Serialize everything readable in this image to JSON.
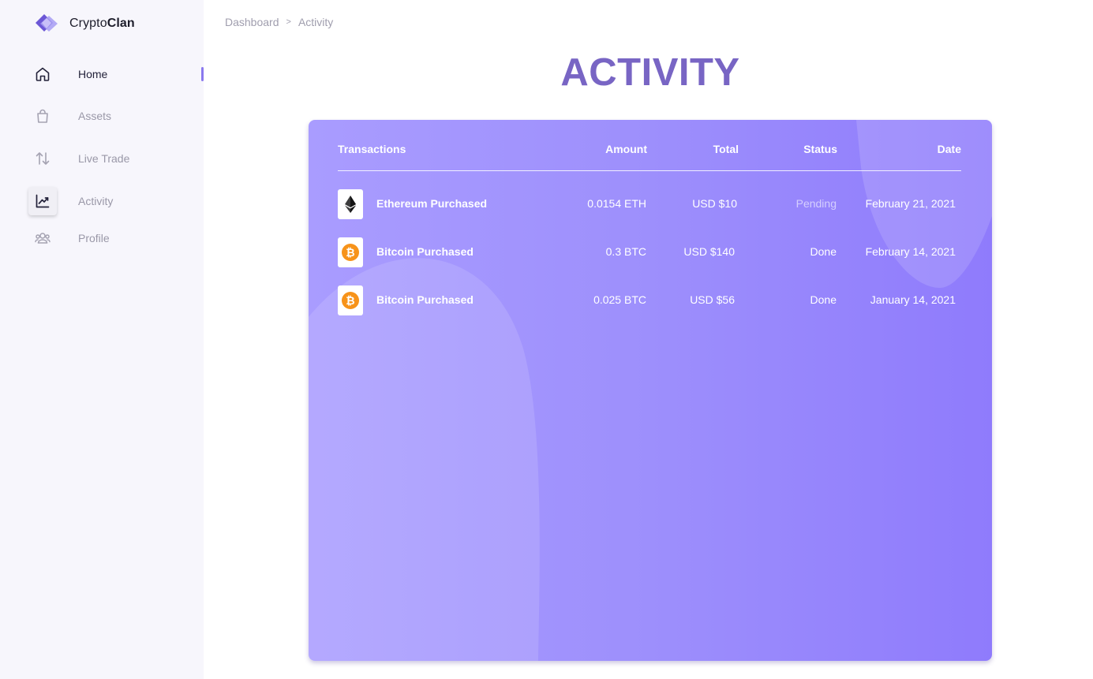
{
  "brand": {
    "name_regular": "Crypto",
    "name_bold": "Clan"
  },
  "sidebar": {
    "items": [
      {
        "label": "Home",
        "icon": "home-icon"
      },
      {
        "label": "Assets",
        "icon": "bag-icon"
      },
      {
        "label": "Live Trade",
        "icon": "arrows-up-down-icon"
      },
      {
        "label": "Activity",
        "icon": "chart-line-icon"
      },
      {
        "label": "Profile",
        "icon": "users-icon"
      }
    ]
  },
  "breadcrumb": {
    "parent": "Dashboard",
    "separator": ">",
    "current": "Activity"
  },
  "page": {
    "title": "ACTIVITY"
  },
  "table": {
    "headers": {
      "transactions": "Transactions",
      "amount": "Amount",
      "total": "Total",
      "status": "Status",
      "date": "Date"
    },
    "rows": [
      {
        "coin": "ethereum-icon",
        "name": "Ethereum Purchased",
        "amount": "0.0154 ETH",
        "total": "USD $10",
        "status": "Pending",
        "date": "February 21, 2021"
      },
      {
        "coin": "bitcoin-icon",
        "name": "Bitcoin Purchased",
        "amount": "0.3 BTC",
        "total": "USD $140",
        "status": "Done",
        "date": "February 14, 2021"
      },
      {
        "coin": "bitcoin-icon",
        "name": "Bitcoin Purchased",
        "amount": "0.025 BTC",
        "total": "USD $56",
        "status": "Done",
        "date": "January 14, 2021"
      }
    ]
  },
  "colors": {
    "accent": "#7865c4",
    "card_start": "#a99cff",
    "card_end": "#8f7bfc",
    "bitcoin": "#f7931a",
    "sidebar_bg": "#f7f6fc"
  }
}
